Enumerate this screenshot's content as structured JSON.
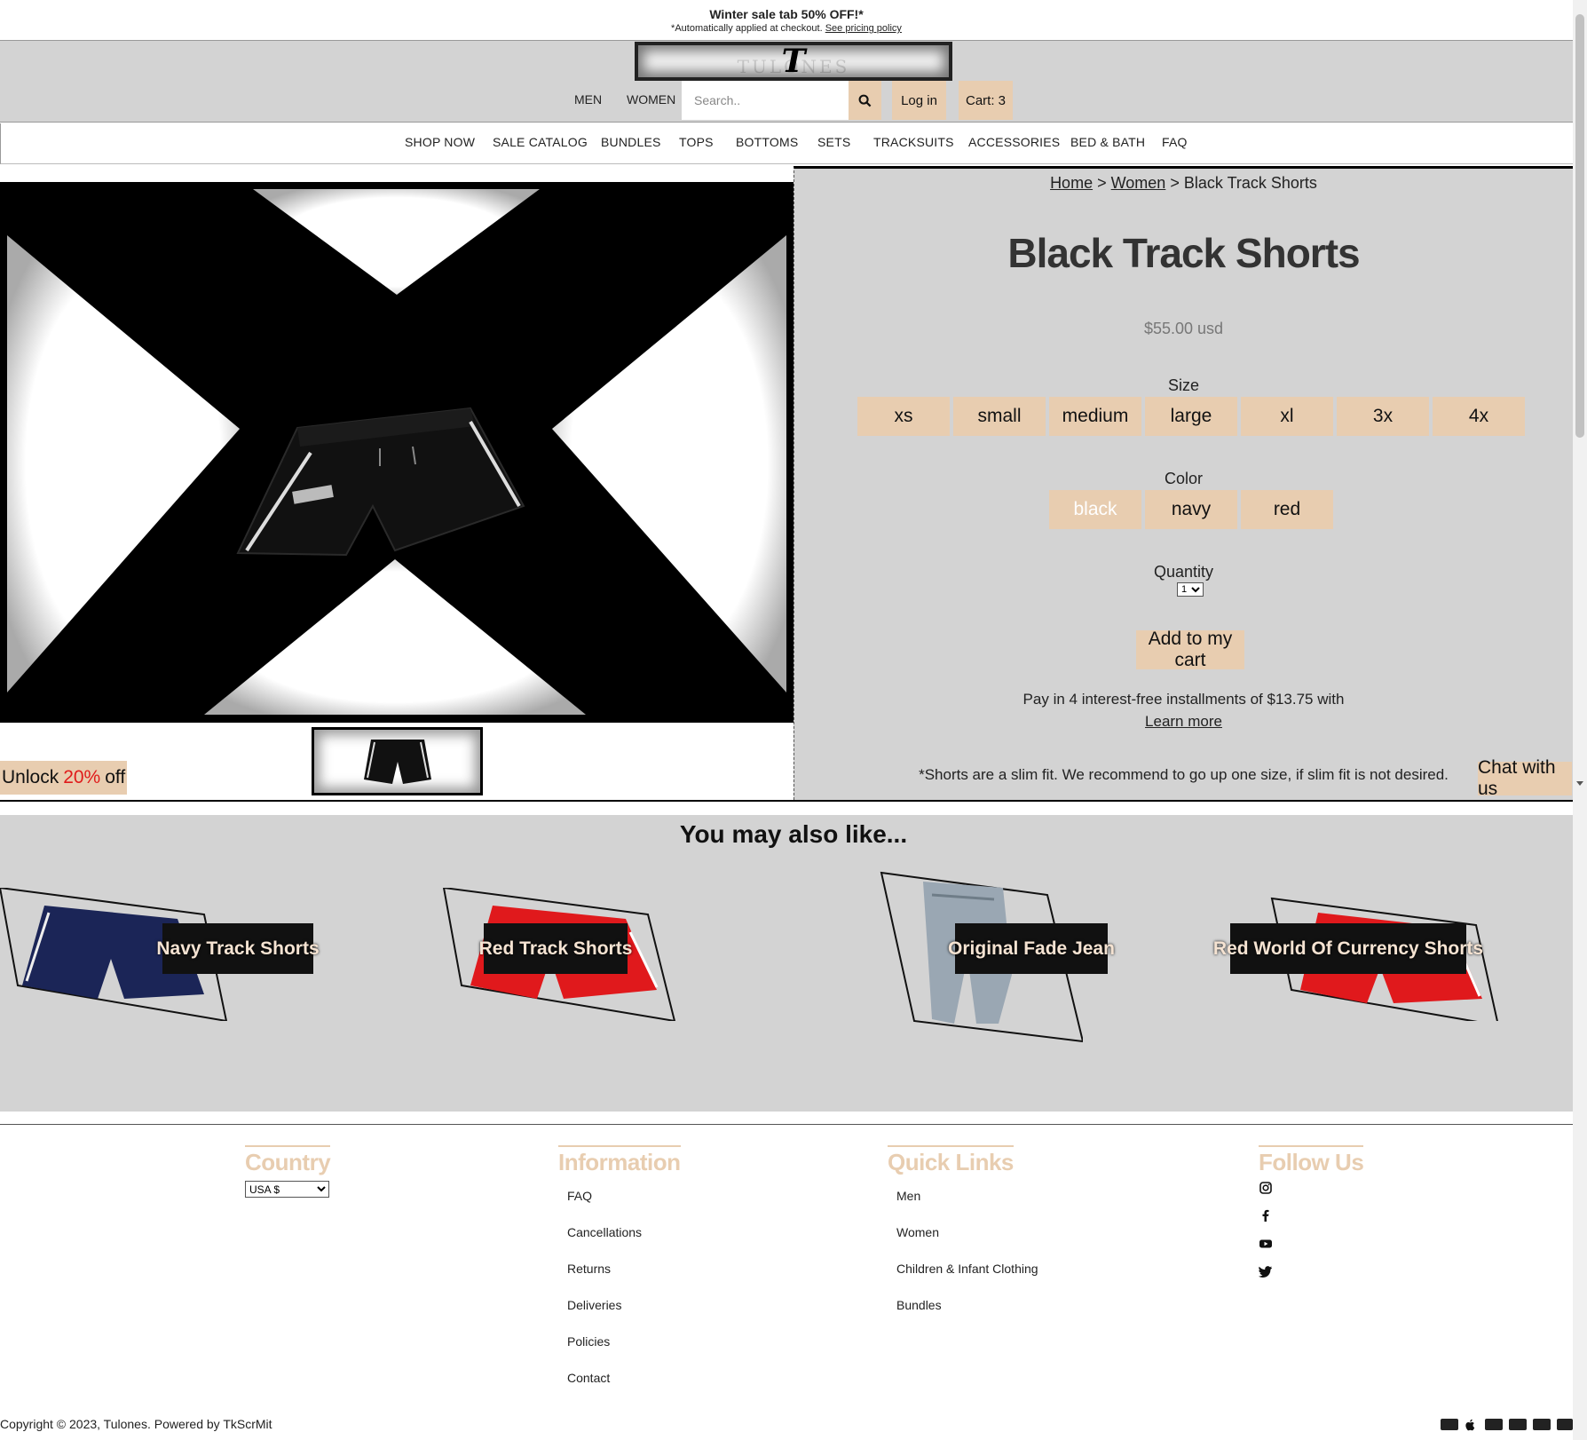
{
  "announcement": {
    "title": "Winter sale tab 50% OFF!*",
    "subtitle": "*Automatically applied at checkout.",
    "link": "See pricing policy"
  },
  "header": {
    "logo_letter": "T",
    "logo_word": "TULONES",
    "nav": [
      "MEN",
      "WOMEN"
    ],
    "search_placeholder": "Search..",
    "login": "Log in",
    "cart": "Cart: 3"
  },
  "categories": [
    "SHOP NOW",
    "SALE CATALOG",
    "BUNDLES",
    "TOPS",
    "BOTTOMS",
    "SETS",
    "TRACKSUITS",
    "ACCESSORIES",
    "BED & BATH",
    "FAQ"
  ],
  "breadcrumb": {
    "home": "Home",
    "sep1": ">",
    "women": "Women",
    "sep2": ">",
    "current": "Black Track Shorts"
  },
  "product": {
    "title": "Black Track Shorts",
    "price": "$55.00 usd",
    "size_label": "Size",
    "sizes": [
      "xs",
      "small",
      "medium",
      "large",
      "xl",
      "3x",
      "4x"
    ],
    "color_label": "Color",
    "colors": [
      "black",
      "navy",
      "red"
    ],
    "selected_color": "black",
    "quantity_label": "Quantity",
    "quantity": "1",
    "add_to_cart": "Add to my cart",
    "installments": "Pay in 4 interest-free installments of $13.75 with",
    "learn_more": "Learn more",
    "fit_note": "*Shorts are a slim fit. We recommend to go up one size, if slim fit is not desired."
  },
  "promo": {
    "prefix": "Unlock",
    "percent": "20%",
    "suffix": "off"
  },
  "chat": "Chat with us",
  "related": {
    "heading": "You may also like...",
    "items": [
      {
        "name": "Navy Track Shorts",
        "color": "#1b2557"
      },
      {
        "name": "Red Track Shorts",
        "color": "#e0191c"
      },
      {
        "name": "Original Fade Jean",
        "color": "#9aa7b3"
      },
      {
        "name": "Red World Of Currency Shorts",
        "color": "#e0191c"
      }
    ]
  },
  "footer": {
    "country_title": "Country",
    "country_value": "USA $",
    "info_title": "Information",
    "info_links": [
      "FAQ",
      "Cancellations",
      "Returns",
      "Deliveries",
      "Policies",
      "Contact"
    ],
    "quick_title": "Quick Links",
    "quick_links": [
      "Men",
      "Women",
      "Children & Infant Clothing",
      "Bundles"
    ],
    "follow_title": "Follow Us",
    "social": [
      "instagram-icon",
      "facebook-icon",
      "youtube-icon",
      "twitter-icon"
    ],
    "copyright": "Copyright © 2023, Tulones. Powered by TkScrMit",
    "payment_icons": [
      "amex-icon",
      "apple-pay-icon",
      "diners-icon",
      "discover-icon",
      "paypal-icon",
      "visa-icon"
    ]
  },
  "colors": {
    "accent": "#e8cdb0",
    "header_bg": "#d3d3d3",
    "promo_red": "#e01b1b"
  }
}
